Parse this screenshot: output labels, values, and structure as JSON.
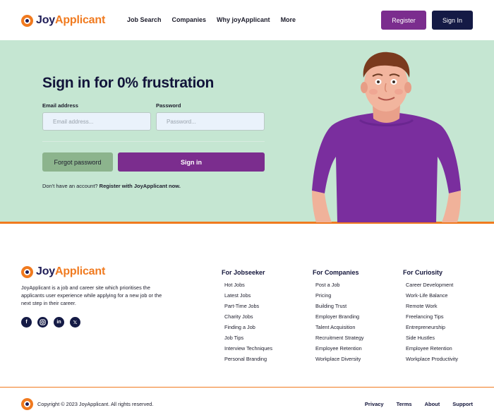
{
  "header": {
    "logo_joy": "Joy",
    "logo_applicant": "Applicant",
    "nav": [
      "Job Search",
      "Companies",
      "Why joyApplicant",
      "More"
    ],
    "register_label": "Register",
    "signin_label": "Sign In"
  },
  "hero": {
    "title": "Sign in for 0% frustration",
    "email_label": "Email address",
    "email_placeholder": "Email address...",
    "password_label": "Password",
    "password_placeholder": "Password...",
    "forgot_label": "Forgot password",
    "signin_label": "Sign in",
    "no_account_text": "Don't have an account?",
    "register_link": "Register with JoyApplicant now."
  },
  "footer": {
    "logo_joy": "Joy",
    "logo_applicant": "Applicant",
    "description": "JoyApplicant is a job and career site which prioritises the applicants user experience while applying for a new job or the next step in their career.",
    "socials": [
      "facebook-icon",
      "instagram-icon",
      "linkedin-icon",
      "x-icon"
    ],
    "columns": [
      {
        "title": "For Jobseeker",
        "items": [
          "Hot Jobs",
          "Latest Jobs",
          "Part-Time Jobs",
          "Charity Jobs",
          "Finding a Job",
          "Job Tips",
          "Interview Techniques",
          "Personal Branding"
        ]
      },
      {
        "title": "For Companies",
        "items": [
          "Post a Job",
          "Pricing",
          "Building Trust",
          "Employer Branding",
          "Talent Acquisition",
          "Recruitment Strategy",
          "Employee Retention",
          "Workplace Diversity"
        ]
      },
      {
        "title": "For Curiosity",
        "items": [
          "Career Development",
          "Work-Life Balance",
          "Remote Work",
          "Freelancing Tips",
          "Entrepreneurship",
          "Side Hustles",
          "Employee Retention",
          "Workplace Productivity"
        ]
      }
    ],
    "copyright": "Copyright © 2023 JoyApplicant. All rights reserved.",
    "links": [
      "Privacy",
      "Terms",
      "About",
      "Support"
    ]
  },
  "colors": {
    "brand_orange": "#f07a1f",
    "brand_navy": "#141a45",
    "brand_purple": "#7b2d8e",
    "hero_green": "#c5e6d2"
  }
}
